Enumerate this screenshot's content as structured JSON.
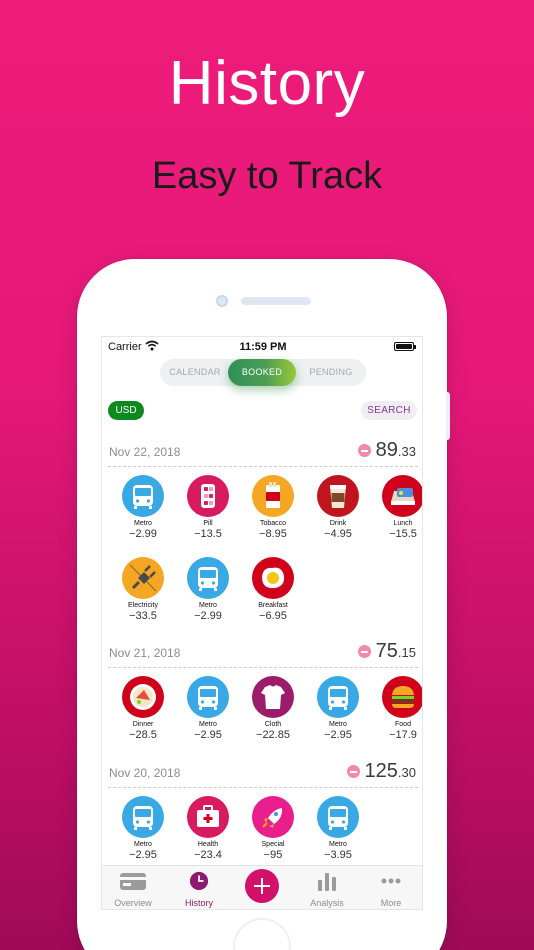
{
  "hero": {
    "title": "History",
    "subtitle": "Easy to Track"
  },
  "status": {
    "carrier": "Carrier",
    "time": "11:59 PM"
  },
  "segments": {
    "calendar": "CALENDAR",
    "booked": "BOOKED",
    "pending": "PENDING",
    "selected": "BOOKED"
  },
  "toolbar": {
    "currency": "USD",
    "search": "SEARCH"
  },
  "days": [
    {
      "date": "Nov 22, 2018",
      "total_main": "89",
      "total_cents": ".33",
      "items": [
        {
          "name": "Metro",
          "amount": "−2.99",
          "icon": "metro-icon"
        },
        {
          "name": "Pill",
          "amount": "−13.5",
          "icon": "pill-icon"
        },
        {
          "name": "Tobacco",
          "amount": "−8.95",
          "icon": "tobacco-icon"
        },
        {
          "name": "Drink",
          "amount": "−4.95",
          "icon": "drink-icon"
        },
        {
          "name": "Lunch",
          "amount": "−15.5",
          "icon": "lunch-icon"
        },
        {
          "name": "Electricity",
          "amount": "−33.5",
          "icon": "plug-icon"
        },
        {
          "name": "Metro",
          "amount": "−2.99",
          "icon": "metro-icon"
        },
        {
          "name": "Breakfast",
          "amount": "−6.95",
          "icon": "egg-icon"
        }
      ]
    },
    {
      "date": "Nov 21, 2018",
      "total_main": "75",
      "total_cents": ".15",
      "items": [
        {
          "name": "Dinner",
          "amount": "−28.5",
          "icon": "dinner-icon"
        },
        {
          "name": "Metro",
          "amount": "−2.95",
          "icon": "metro-icon"
        },
        {
          "name": "Cloth",
          "amount": "−22.85",
          "icon": "shirt-icon"
        },
        {
          "name": "Metro",
          "amount": "−2.95",
          "icon": "metro-icon"
        },
        {
          "name": "Food",
          "amount": "−17.9",
          "icon": "burger-icon"
        }
      ]
    },
    {
      "date": "Nov 20, 2018",
      "total_main": "125",
      "total_cents": ".30",
      "items": [
        {
          "name": "Metro",
          "amount": "−2.95",
          "icon": "metro-icon"
        },
        {
          "name": "Health",
          "amount": "−23.4",
          "icon": "health-icon"
        },
        {
          "name": "Special",
          "amount": "−95",
          "icon": "rocket-icon"
        },
        {
          "name": "Metro",
          "amount": "−3.95",
          "icon": "metro-icon"
        }
      ]
    }
  ],
  "tabbar": {
    "overview": "Overview",
    "history": "History",
    "analysis": "Analysis",
    "more": "More",
    "active": "History"
  },
  "colors": {
    "background": "#e51878",
    "booked_green": "#4c9e52",
    "usd_green": "#0c8a1d",
    "accent_purple": "#8d1a6e"
  }
}
